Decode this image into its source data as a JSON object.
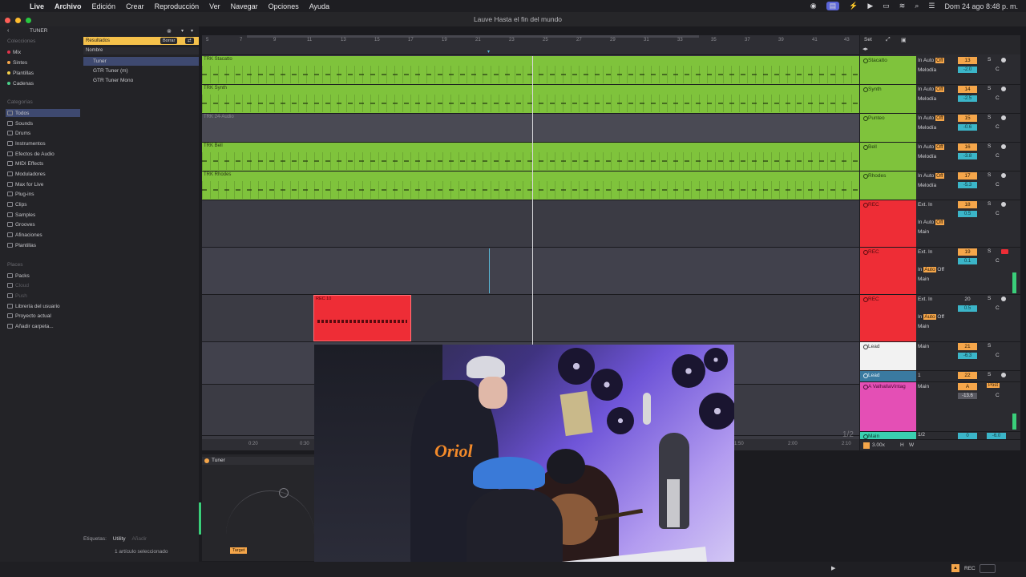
{
  "menubar": {
    "app": "Live",
    "items": [
      "Archivo",
      "Edición",
      "Crear",
      "Reproducción",
      "Ver",
      "Navegar",
      "Opciones",
      "Ayuda"
    ],
    "clock": "Dom 24 ago  8:48 p. m."
  },
  "window": {
    "title": "Lauve Hasta el fin del mundo"
  },
  "browser": {
    "search": "TUNER",
    "collections_title": "Colecciones",
    "collections": [
      {
        "label": "Mix",
        "color": "#e0334a"
      },
      {
        "label": "Sintes",
        "color": "#f5a64a"
      },
      {
        "label": "Plantillas",
        "color": "#f5d04a"
      },
      {
        "label": "Cadenas",
        "color": "#4ad08a"
      }
    ],
    "categories_title": "Categorías",
    "categories": [
      "Todos",
      "Sounds",
      "Drums",
      "Instrumentos",
      "Efectos de Audio",
      "MIDI Effects",
      "Moduladores",
      "Max for Live",
      "Plug-ins",
      "Clips",
      "Samples",
      "Grooves",
      "Afinaciones",
      "Plantillas"
    ],
    "places_title": "Places",
    "places": [
      "Packs",
      "Cloud",
      "Push",
      "Librería del usuario",
      "Proyecto actual",
      "Añadir carpeta..."
    ],
    "results": {
      "header": "Resultados",
      "clear_button": "Borrar",
      "column": "Nombre",
      "items": [
        "Tuner",
        "GTR Tuner (m)",
        "GTR Tuner Mono"
      ]
    },
    "tags_label": "Etiquetas:",
    "tag_utility": "Utility",
    "tag_add": "Añadir",
    "selection_status": "1 artículo seleccionado"
  },
  "ruler": {
    "bars": [
      "5",
      "7",
      "9",
      "11",
      "13",
      "15",
      "17",
      "19",
      "21",
      "23",
      "25",
      "27",
      "29",
      "31",
      "33",
      "35",
      "37",
      "39",
      "41",
      "43"
    ],
    "times": [
      "0:20",
      "0:30",
      "1:50",
      "2:00",
      "2:10"
    ]
  },
  "tracks": [
    {
      "name": "TRK Stacatto",
      "type": "green"
    },
    {
      "name": "TRK Synth",
      "type": "green"
    },
    {
      "name": "TRK 24-Audio",
      "type": "audio"
    },
    {
      "name": "TRK Bell",
      "type": "green"
    },
    {
      "name": "TRK Rhodes",
      "type": "green"
    }
  ],
  "clip": {
    "name": "REC 10"
  },
  "mixer": {
    "header": "Set",
    "channels": [
      {
        "name": "Stacatto",
        "input": "In",
        "auto": "Auto",
        "off": "Off",
        "routing": "Melodía",
        "num": "13",
        "vol": "-2.0",
        "color": "#7fc33c"
      },
      {
        "name": "Synth",
        "input": "In",
        "auto": "Auto",
        "off": "Off",
        "routing": "Melodía",
        "num": "14",
        "vol": "-2.5",
        "color": "#7fc33c"
      },
      {
        "name": "Punteo",
        "input": "In",
        "auto": "Auto",
        "off": "Off",
        "routing": "Melodía",
        "num": "15",
        "vol": "-0.6",
        "color": "#7fc33c"
      },
      {
        "name": "Bell",
        "input": "In",
        "auto": "Auto",
        "off": "Off",
        "routing": "Melodía",
        "num": "16",
        "vol": "-3.8",
        "color": "#7fc33c"
      },
      {
        "name": "Rhodes",
        "input": "In",
        "auto": "Auto",
        "off": "Off",
        "routing": "Melodía",
        "num": "17",
        "vol": "-5.3",
        "color": "#7fc33c"
      },
      {
        "name": "REC",
        "input": "Ext. In",
        "auto": "Auto",
        "off": "Off",
        "routing": "Main",
        "num": "18",
        "vol": "0.5",
        "color": "#ee2d36"
      },
      {
        "name": "REC",
        "input": "Ext. In",
        "auto": "Auto",
        "off": "Off",
        "routing": "Main",
        "num": "19",
        "vol": "0.1",
        "color": "#ee2d36"
      },
      {
        "name": "REC",
        "input": "Ext. In",
        "auto": "Auto",
        "off": "Off",
        "routing": "Main",
        "num": "20",
        "vol": "0.5",
        "color": "#ee2d36"
      },
      {
        "name": "Lead",
        "input": "Main",
        "auto": "",
        "off": "",
        "routing": "",
        "num": "21",
        "vol": "-6.3",
        "color": "#f2f2f2"
      },
      {
        "name": "Lead",
        "input": "1",
        "auto": "",
        "off": "",
        "routing": "",
        "num": "22",
        "vol": "",
        "color": "#3a7aa0"
      },
      {
        "name": "A ValhallaVintag",
        "input": "Main",
        "auto": "",
        "off": "Post",
        "routing": "",
        "num": "A",
        "vol": "-13.6",
        "color": "#e44fb5"
      },
      {
        "name": "Main",
        "input": "1/2",
        "auto": "",
        "off": "",
        "routing": "",
        "num": "0",
        "vol": "-6.0",
        "color": "#3acfb0"
      }
    ],
    "page": "1/2",
    "zoom": "3.00x"
  },
  "device": {
    "name": "Tuner",
    "target": "Target"
  },
  "status": {
    "rec": "REC"
  }
}
